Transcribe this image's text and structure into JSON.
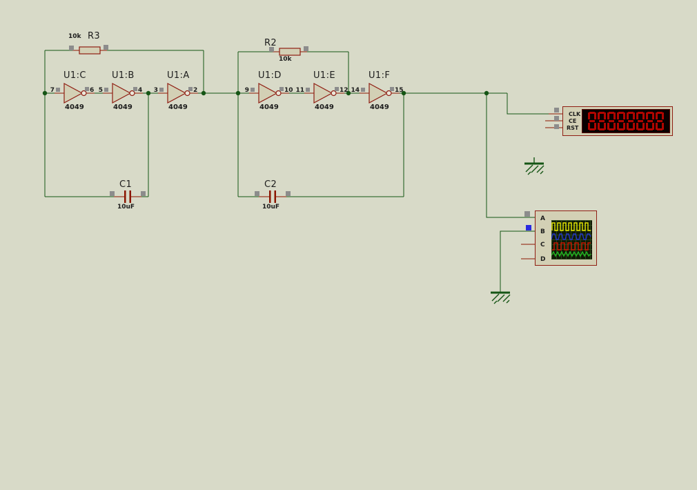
{
  "palette": {
    "background": "#d8dac8",
    "wire": "#155515",
    "lead": "#8b1500",
    "component_fill": "#d3d0b5",
    "component_outline": "#8f1d12",
    "text": "#1c1c1c",
    "marker_gray": "#8c8c8c",
    "marker_blue": "#2a2ae0",
    "display_bg": "#0a0000",
    "display_segment": "#b00500",
    "screen_bg": "#101a06",
    "screen_grid": "#2c461c"
  },
  "inverters": [
    {
      "ref": "U1:C",
      "part": "4049",
      "pin_in": "7",
      "pin_out": "6"
    },
    {
      "ref": "U1:B",
      "part": "4049",
      "pin_in": "5",
      "pin_out": "4"
    },
    {
      "ref": "U1:A",
      "part": "4049",
      "pin_in": "3",
      "pin_out": "2"
    },
    {
      "ref": "U1:D",
      "part": "4049",
      "pin_in": "9",
      "pin_out": "10"
    },
    {
      "ref": "U1:E",
      "part": "4049",
      "pin_in": "11",
      "pin_out": "12"
    },
    {
      "ref": "U1:F",
      "part": "4049",
      "pin_in": "14",
      "pin_out": "15"
    }
  ],
  "resistors": [
    {
      "ref": "R3",
      "value": "10k"
    },
    {
      "ref": "R2",
      "value": "10k"
    }
  ],
  "capacitors": [
    {
      "ref": "C1",
      "value": "10uF"
    },
    {
      "ref": "C2",
      "value": "10uF"
    }
  ],
  "counter": {
    "pin_labels": [
      "CLK",
      "CE",
      "RST"
    ],
    "digit_count": 8
  },
  "oscilloscope": {
    "channel_labels": [
      "A",
      "B",
      "C",
      "D"
    ],
    "channel_colors": {
      "a": "#e8e800",
      "b": "#2233cc",
      "c": "#cc1800",
      "d": "#20b420"
    }
  }
}
